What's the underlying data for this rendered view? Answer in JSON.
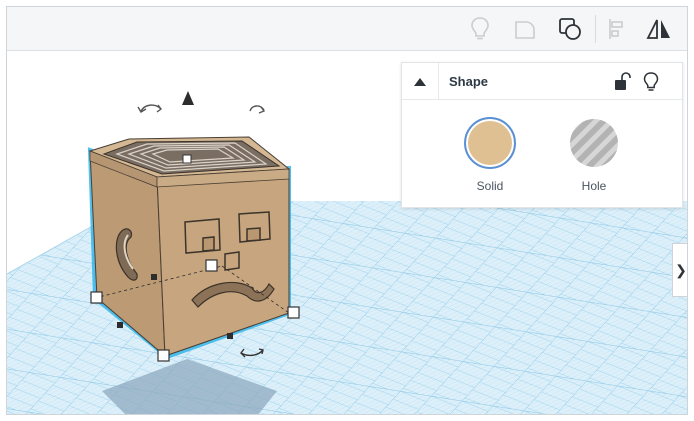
{
  "toolbar": {
    "buttons": [
      {
        "name": "lightbulb-icon",
        "enabled": false
      },
      {
        "name": "group-icon",
        "enabled": false
      },
      {
        "name": "ungroup-icon",
        "enabled": true
      },
      {
        "name": "align-icon",
        "enabled": false
      },
      {
        "name": "mirror-icon",
        "enabled": true
      }
    ]
  },
  "shape_panel": {
    "title": "Shape",
    "collapse_icon": "triangle-up-icon",
    "lock_icon": "unlock-icon",
    "bulb_icon": "lightbulb-icon",
    "options": [
      {
        "label": "Solid",
        "selected": true,
        "color": "#dfc093"
      },
      {
        "label": "Hole",
        "selected": false
      }
    ]
  },
  "expand_tab_glyph": "❯",
  "colors": {
    "accent": "#5a91d6",
    "shape_fill": "#c6a57f",
    "grid": "#c7e4f3"
  }
}
